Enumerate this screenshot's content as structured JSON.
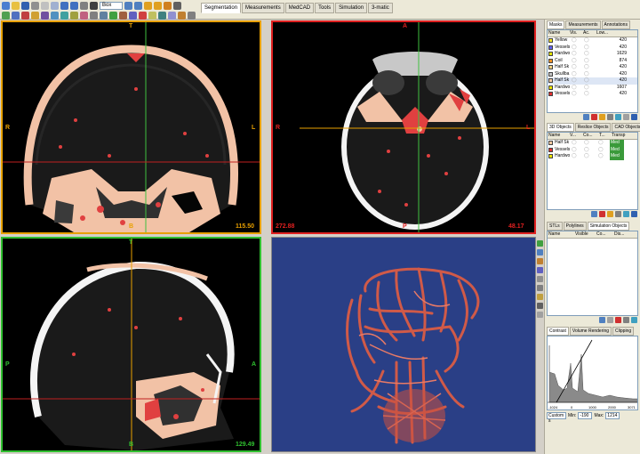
{
  "toolbar": {
    "zoom_combo": "Box",
    "tabs": [
      {
        "label": "Segmentation",
        "active": true
      },
      {
        "label": "Measurements",
        "active": false
      },
      {
        "label": "MedCAD",
        "active": false
      },
      {
        "label": "Tools",
        "active": false
      },
      {
        "label": "Simulation",
        "active": false
      },
      {
        "label": "3-matic",
        "active": false
      }
    ]
  },
  "viewports": {
    "coronal": {
      "top": "T",
      "bottom": "B",
      "left": "R",
      "right": "L",
      "value": "115.50",
      "border_color": "#e8a000"
    },
    "axial": {
      "top": "A",
      "bottom": "P",
      "left": "R",
      "right": "L",
      "left_value": "272.88",
      "right_value": "48.17",
      "border_color": "#e02020"
    },
    "sagittal": {
      "top": "T",
      "bottom": "B",
      "left": "P",
      "right": "A",
      "value": "129.49",
      "border_color": "#30c030"
    },
    "render3d": {
      "background": "#2a3f86"
    }
  },
  "masks_panel": {
    "tabs": [
      "Masks",
      "Measurements",
      "Annotations"
    ],
    "columns": [
      "Name",
      "Vis.",
      "Ac.",
      "Low...",
      ""
    ],
    "rows": [
      {
        "name": "Yellow",
        "low": "420",
        "color": "#f0e020"
      },
      {
        "name": "Vessels",
        "low": "420",
        "color": "#6060f0"
      },
      {
        "name": "Hardwo",
        "low": "1629",
        "color": "#e0e000"
      },
      {
        "name": "Coil",
        "low": "874",
        "color": "#f09020"
      },
      {
        "name": "Half Sk",
        "low": "420",
        "color": "#f0d080"
      },
      {
        "name": "Skullba",
        "low": "420",
        "color": "#c0c0c0"
      },
      {
        "name": "Half Sk",
        "low": "420",
        "color": "#f0c8a0"
      },
      {
        "name": "Hardwo",
        "low": "1607",
        "color": "#e8e000"
      },
      {
        "name": "Vessels",
        "low": "420",
        "color": "#e03030"
      }
    ]
  },
  "objects_panel": {
    "tabs": [
      "3D Objects",
      "Reslice Objects",
      "CAD Objects"
    ],
    "columns": [
      "Name",
      "V...",
      "Co...",
      "T...",
      "Transp"
    ],
    "rows": [
      {
        "name": "Half Sk",
        "transp": "Med",
        "color": "#f0c8a0"
      },
      {
        "name": "Vessels",
        "transp": "Med",
        "color": "#e03030"
      },
      {
        "name": "Hardwo",
        "transp": "Med",
        "color": "#e8e000"
      }
    ]
  },
  "simulation_panel": {
    "tabs": [
      "STLs",
      "Polylines",
      "Simulation Objects"
    ],
    "columns": [
      "Name",
      "Visible",
      "Co...",
      "Dis..."
    ]
  },
  "contrast_panel": {
    "tabs": [
      "Contrast",
      "Volume Rendering",
      "Clipping"
    ],
    "axis_ticks": [
      "-1024",
      "0",
      "1000",
      "2000",
      "3071"
    ],
    "preset": "Custom s",
    "min_label": "Min:",
    "min_value": "-190",
    "max_label": "Max:",
    "max_value": "1214"
  }
}
